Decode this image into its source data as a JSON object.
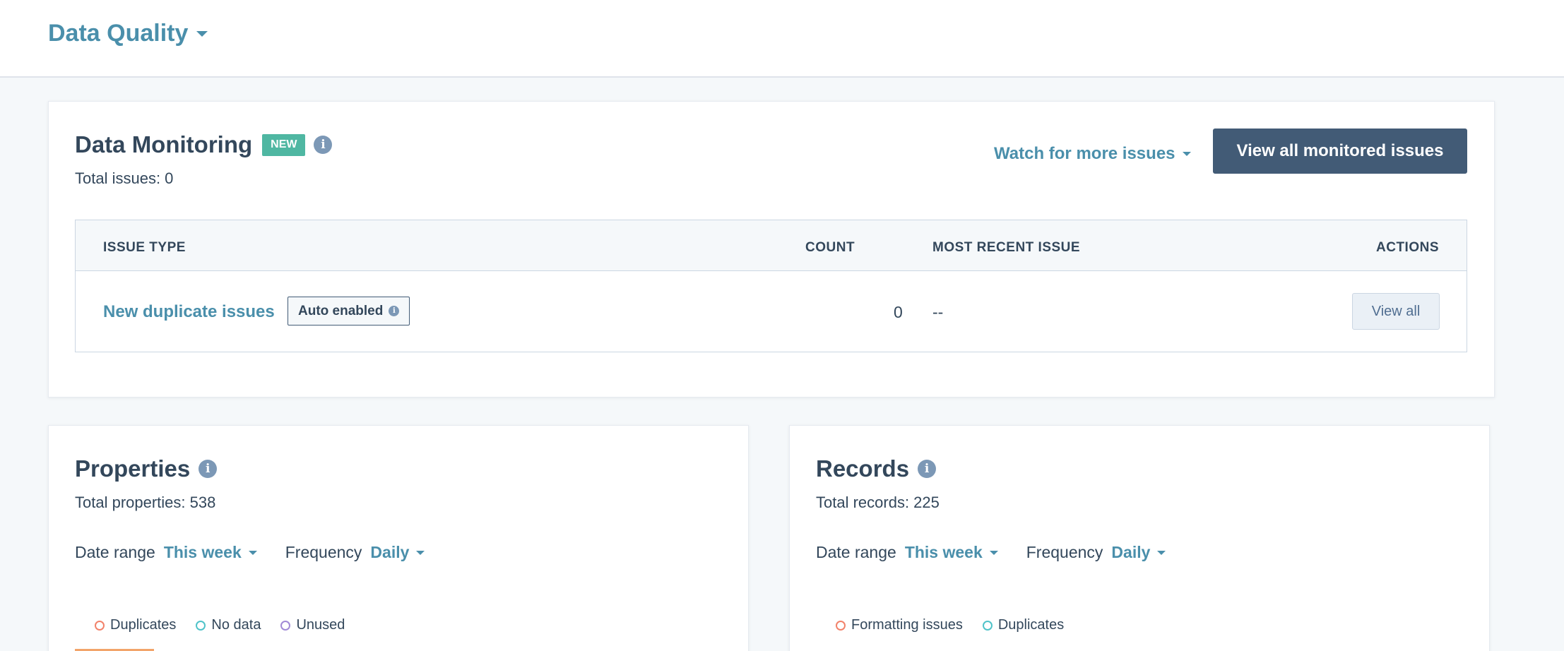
{
  "header": {
    "title": "Data Quality"
  },
  "monitoring": {
    "title": "Data Monitoring",
    "badge": "NEW",
    "total": "Total issues: 0",
    "watch_link": "Watch for more issues",
    "view_all_button": "View all monitored issues",
    "table": {
      "headers": {
        "issue_type": "ISSUE TYPE",
        "count": "COUNT",
        "most_recent": "MOST RECENT ISSUE",
        "actions": "ACTIONS"
      },
      "rows": [
        {
          "issue_type": "New duplicate issues",
          "tag": "Auto enabled",
          "count": "0",
          "most_recent": "--",
          "action": "View all"
        }
      ]
    }
  },
  "properties": {
    "title": "Properties",
    "total": "Total properties: 538",
    "date_range_label": "Date range",
    "date_range_value": "This week",
    "frequency_label": "Frequency",
    "frequency_value": "Daily",
    "legend": [
      {
        "label": "Duplicates",
        "color": "#f2826a"
      },
      {
        "label": "No data",
        "color": "#4fc3c9"
      },
      {
        "label": "Unused",
        "color": "#a18ad6"
      }
    ]
  },
  "records": {
    "title": "Records",
    "total": "Total records: 225",
    "date_range_label": "Date range",
    "date_range_value": "This week",
    "frequency_label": "Frequency",
    "frequency_value": "Daily",
    "legend": [
      {
        "label": "Formatting issues",
        "color": "#f2826a"
      },
      {
        "label": "Duplicates",
        "color": "#4fc3c9"
      }
    ]
  },
  "colors": {
    "accent": "#4a8fab",
    "primary_button": "#425b76",
    "badge_new": "#4fb7a2",
    "text": "#33475b"
  }
}
